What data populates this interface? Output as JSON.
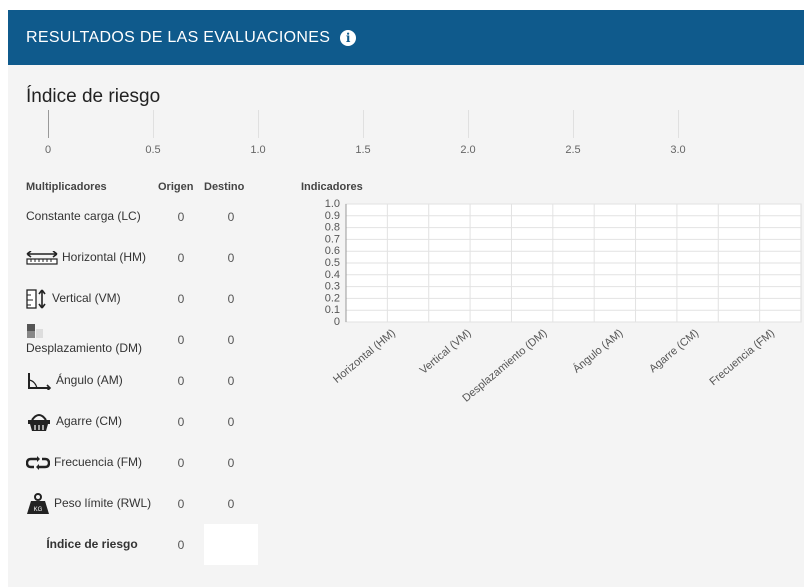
{
  "header": {
    "title": "RESULTADOS DE LAS EVALUACIONES",
    "info_icon": "info-icon"
  },
  "risk_index": {
    "title": "Índice de riesgo",
    "scale_ticks": [
      "0",
      "0.5",
      "1.0",
      "1.5",
      "2.0",
      "2.5",
      "3.0"
    ]
  },
  "multipliers": {
    "headers": [
      "Multiplicadores",
      "Origen",
      "Destino"
    ],
    "rows": [
      {
        "label": "Constante carga (LC)",
        "icon": "",
        "origin": "0",
        "dest": "0"
      },
      {
        "label": "Horizontal (HM)",
        "icon": "ruler-icon",
        "origin": "0",
        "dest": "0"
      },
      {
        "label": "Vertical (VM)",
        "icon": "vertical-icon",
        "origin": "0",
        "dest": "0"
      },
      {
        "label": "Desplazamiento (DM)",
        "icon": "displacement-icon",
        "origin": "0",
        "dest": "0"
      },
      {
        "label": "Ángulo (AM)",
        "icon": "angle-icon",
        "origin": "0",
        "dest": "0"
      },
      {
        "label": "Agarre (CM)",
        "icon": "basket-icon",
        "origin": "0",
        "dest": "0"
      },
      {
        "label": "Frecuencia (FM)",
        "icon": "frequency-icon",
        "origin": "0",
        "dest": "0"
      },
      {
        "label": "Peso límite (RWL)",
        "icon": "weight-icon",
        "origin": "0",
        "dest": "0"
      }
    ],
    "risk_row": {
      "label": "Índice de riesgo",
      "origin": "0"
    }
  },
  "chart_data": {
    "type": "bar",
    "title": "Indicadores",
    "categories": [
      "Horizontal (HM)",
      "Vertical (VM)",
      "Desplazamiento (DM)",
      "Ángulo (AM)",
      "Agarre (CM)",
      "Frecuencia (FM)"
    ],
    "values": [
      0,
      0,
      0,
      0,
      0,
      0
    ],
    "yticks": [
      "1.0",
      "0.9",
      "0.8",
      "0.7",
      "0.6",
      "0.5",
      "0.4",
      "0.3",
      "0.2",
      "0.1",
      "0"
    ],
    "ylim": [
      0,
      1
    ],
    "grid": true
  }
}
